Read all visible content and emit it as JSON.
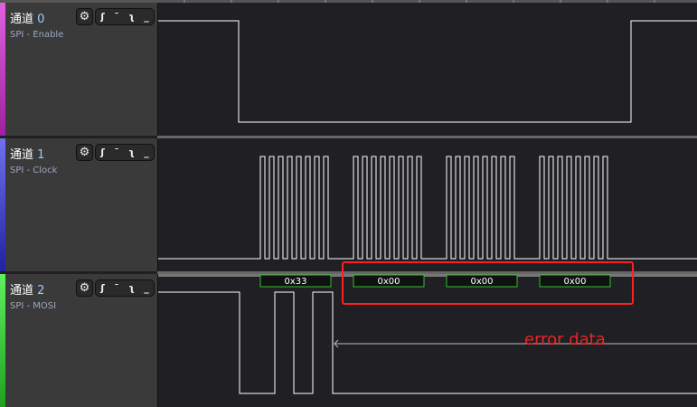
{
  "channels": [
    {
      "label": "通道",
      "num": "0",
      "sub": "SPI - Enable",
      "color": "#e040e0"
    },
    {
      "label": "通道",
      "num": "1",
      "sub": "SPI - Clock",
      "color": "#4040e0"
    },
    {
      "label": "通道",
      "num": "2",
      "sub": "SPI - MOSI",
      "color": "#30d030"
    }
  ],
  "trigger_icons": [
    "rising-edge",
    "high",
    "falling-edge",
    "low"
  ],
  "decoded": [
    "0x33",
    "0x00",
    "0x00",
    "0x00"
  ],
  "annotation": "error data",
  "colors": {
    "highlight": "#ff2020",
    "decode_border": "#30c030"
  }
}
